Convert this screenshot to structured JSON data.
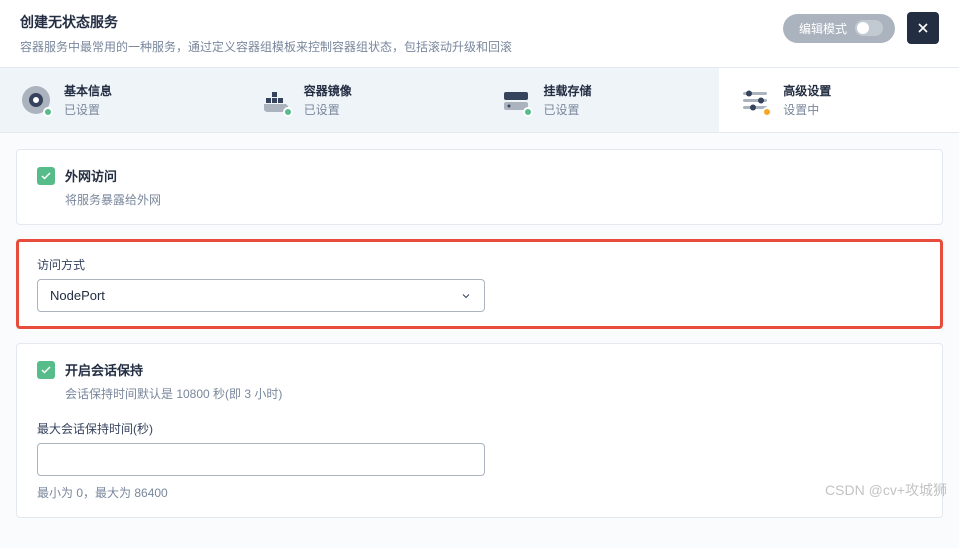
{
  "header": {
    "title": "创建无状态服务",
    "subtitle": "容器服务中最常用的一种服务，通过定义容器组模板来控制容器组状态，包括滚动升级和回滚",
    "edit_mode_label": "编辑模式"
  },
  "steps": [
    {
      "title": "基本信息",
      "status": "已设置",
      "icon": "info"
    },
    {
      "title": "容器镜像",
      "status": "已设置",
      "icon": "container"
    },
    {
      "title": "挂载存储",
      "status": "已设置",
      "icon": "storage"
    },
    {
      "title": "高级设置",
      "status": "设置中",
      "icon": "advanced",
      "active": true
    }
  ],
  "external_access": {
    "title": "外网访问",
    "description": "将服务暴露给外网",
    "access_method_label": "访问方式",
    "access_method_value": "NodePort"
  },
  "session_persistence": {
    "title": "开启会话保持",
    "description": "会话保持时间默认是 10800 秒(即 3 小时)",
    "timeout_label": "最大会话保持时间(秒)",
    "timeout_value": "",
    "hint": "最小为 0，最大为 86400"
  },
  "watermark": "CSDN @cv+攻城狮"
}
